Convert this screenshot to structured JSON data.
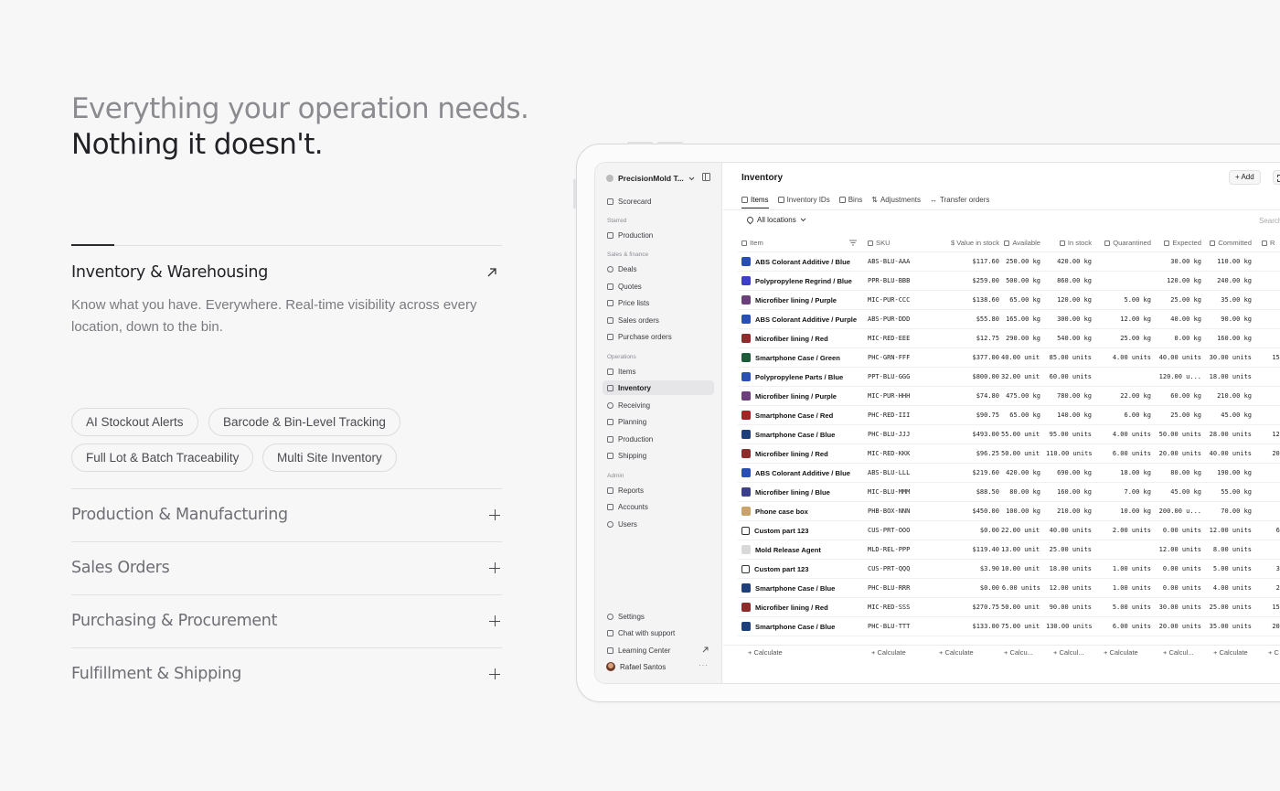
{
  "headline": {
    "line1": "Everything your operation needs.",
    "line2": "Nothing it doesn't."
  },
  "accordion": {
    "open": {
      "title": "Inventory & Warehousing",
      "description": "Know what you have. Everywhere. Real-time visibility across every location, down to the bin.",
      "tags": [
        "AI Stockout Alerts",
        "Barcode & Bin-Level Tracking",
        "Full Lot & Batch Traceability",
        "Multi Site Inventory"
      ]
    },
    "closed": [
      "Production & Manufacturing",
      "Sales Orders",
      "Purchasing & Procurement",
      "Fulfillment & Shipping"
    ]
  },
  "app": {
    "workspace": "PrecisionMold T...",
    "sidebar": {
      "top_item": "Scorecard",
      "sections": [
        {
          "label": "Starred",
          "items": [
            "Production"
          ]
        },
        {
          "label": "Sales & finance",
          "items": [
            "Deals",
            "Quotes",
            "Price lists",
            "Sales orders",
            "Purchase orders"
          ]
        },
        {
          "label": "Operations",
          "items": [
            "Items",
            "Inventory",
            "Receiving",
            "Planning",
            "Production",
            "Shipping"
          ]
        },
        {
          "label": "Admin",
          "items": [
            "Reports",
            "Accounts",
            "Users"
          ]
        }
      ],
      "footer": [
        "Settings",
        "Chat with support",
        "Learning Center"
      ],
      "user": "Rafael Santos"
    },
    "page_title": "Inventory",
    "add_label": "+ Add",
    "tabs": [
      "Items",
      "Inventory IDs",
      "Bins",
      "Adjustments",
      "Transfer orders"
    ],
    "location_filter": "All locations",
    "search_placeholder": "Search",
    "columns": [
      "Item",
      "SKU",
      "Value in stock",
      "Available",
      "In stock",
      "Quarantined",
      "Expected",
      "Committed",
      "R"
    ],
    "rows": [
      {
        "item": "ABS Colorant Additive / Blue",
        "sku": "ABS-BLU-AAA",
        "value": "$117.60",
        "available": "250.00 kg",
        "in_stock": "420.00 kg",
        "quarantined": "",
        "expected": "30.00 kg",
        "committed": "110.00 kg",
        "rest": "",
        "thumb": "#2a4fb3"
      },
      {
        "item": "Polypropylene Regrind / Blue",
        "sku": "PPR-BLU-BBB",
        "value": "$259.00",
        "available": "500.00 kg",
        "in_stock": "860.00 kg",
        "quarantined": "",
        "expected": "120.00 kg",
        "committed": "240.00 kg",
        "rest": "",
        "thumb": "#3d3fc9"
      },
      {
        "item": "Microfiber lining / Purple",
        "sku": "MIC-PUR-CCC",
        "value": "$138.60",
        "available": "65.00 kg",
        "in_stock": "120.00 kg",
        "quarantined": "5.00 kg",
        "expected": "25.00 kg",
        "committed": "35.00 kg",
        "rest": "2",
        "thumb": "#6a3f7a"
      },
      {
        "item": "ABS Colorant Additive / Purple",
        "sku": "ABS-PUR-DDD",
        "value": "$55.80",
        "available": "165.00 kg",
        "in_stock": "300.00 kg",
        "quarantined": "12.00 kg",
        "expected": "40.00 kg",
        "committed": "90.00 kg",
        "rest": "4",
        "thumb": "#2a4fb3"
      },
      {
        "item": "Microfiber lining / Red",
        "sku": "MIC-RED-EEE",
        "value": "$12.75",
        "available": "290.00 kg",
        "in_stock": "540.00 kg",
        "quarantined": "25.00 kg",
        "expected": "0.00 kg",
        "committed": "160.00 kg",
        "rest": "9",
        "thumb": "#8e2b2b"
      },
      {
        "item": "Smartphone Case / Green",
        "sku": "PHC-GRN-FFF",
        "value": "$377.00",
        "available": "40.00 units",
        "in_stock": "85.00 units",
        "quarantined": "4.00 units",
        "expected": "40.00 units",
        "committed": "30.00 units",
        "rest": "15.",
        "thumb": "#1f5a3a"
      },
      {
        "item": "Polypropylene Parts / Blue",
        "sku": "PPT-BLU-GGG",
        "value": "$800.00",
        "available": "32.00 units",
        "in_stock": "60.00 units",
        "quarantined": "",
        "expected": "120.00 u...",
        "committed": "18.00 units",
        "rest": "",
        "thumb": "#2a4fb3"
      },
      {
        "item": "Microfiber lining / Purple",
        "sku": "MIC-PUR-HHH",
        "value": "$74.80",
        "available": "475.00 kg",
        "in_stock": "780.00 kg",
        "quarantined": "22.00 kg",
        "expected": "60.00 kg",
        "committed": "210.00 kg",
        "rest": "9",
        "thumb": "#6a3f7a"
      },
      {
        "item": "Smartphone Case / Red",
        "sku": "PHC-RED-III",
        "value": "$90.75",
        "available": "65.00 kg",
        "in_stock": "140.00 kg",
        "quarantined": "6.00 kg",
        "expected": "25.00 kg",
        "committed": "45.00 kg",
        "rest": "3",
        "thumb": "#a32626"
      },
      {
        "item": "Smartphone Case / Blue",
        "sku": "PHC-BLU-JJJ",
        "value": "$493.00",
        "available": "55.00 units",
        "in_stock": "95.00 units",
        "quarantined": "4.00 units",
        "expected": "50.00 units",
        "committed": "28.00 units",
        "rest": "12.",
        "thumb": "#1d3f7a"
      },
      {
        "item": "Microfiber lining / Red",
        "sku": "MIC-RED-KKK",
        "value": "$96.25",
        "available": "50.00 units",
        "in_stock": "110.00 units",
        "quarantined": "6.00 units",
        "expected": "20.00 units",
        "committed": "40.00 units",
        "rest": "20.",
        "thumb": "#8e2b2b"
      },
      {
        "item": "ABS Colorant Additive / Blue",
        "sku": "ABS-BLU-LLL",
        "value": "$219.60",
        "available": "420.00 kg",
        "in_stock": "690.00 kg",
        "quarantined": "18.00 kg",
        "expected": "80.00 kg",
        "committed": "190.00 kg",
        "rest": "8",
        "thumb": "#2a4fb3"
      },
      {
        "item": "Microfiber lining / Blue",
        "sku": "MIC-BLU-MMM",
        "value": "$88.50",
        "available": "80.00 kg",
        "in_stock": "160.00 kg",
        "quarantined": "7.00 kg",
        "expected": "45.00 kg",
        "committed": "55.00 kg",
        "rest": "2",
        "thumb": "#3a3f8e"
      },
      {
        "item": "Phone case box",
        "sku": "PHB-BOX-NNN",
        "value": "$450.00",
        "available": "100.00 kg",
        "in_stock": "210.00 kg",
        "quarantined": "10.00 kg",
        "expected": "200.00 u...",
        "committed": "70.00 kg",
        "rest": "4",
        "thumb": "#c9a36a"
      },
      {
        "item": "Custom part 123",
        "sku": "CUS-PRT-OOO",
        "value": "$0.00",
        "available": "22.00 units",
        "in_stock": "40.00 units",
        "quarantined": "2.00 units",
        "expected": "0.00 units",
        "committed": "12.00 units",
        "rest": "6.",
        "thumb": ""
      },
      {
        "item": "Mold Release Agent",
        "sku": "MLD-REL-PPP",
        "value": "$119.40",
        "available": "13.00 units",
        "in_stock": "25.00 units",
        "quarantined": "",
        "expected": "12.00 units",
        "committed": "8.00 units",
        "rest": "",
        "thumb": "#d8d8d8"
      },
      {
        "item": "Custom part 123",
        "sku": "CUS-PRT-QQQ",
        "value": "$3.90",
        "available": "10.00 units",
        "in_stock": "18.00 units",
        "quarantined": "1.00 units",
        "expected": "0.00 units",
        "committed": "5.00 units",
        "rest": "3.",
        "thumb": ""
      },
      {
        "item": "Smartphone Case / Blue",
        "sku": "PHC-BLU-RRR",
        "value": "$0.00",
        "available": "6.00 units",
        "in_stock": "12.00 units",
        "quarantined": "1.00 units",
        "expected": "0.00 units",
        "committed": "4.00 units",
        "rest": "2.",
        "thumb": "#1d3f7a"
      },
      {
        "item": "Microfiber lining / Red",
        "sku": "MIC-RED-SSS",
        "value": "$270.75",
        "available": "50.00 units",
        "in_stock": "90.00 units",
        "quarantined": "5.00 units",
        "expected": "30.00 units",
        "committed": "25.00 units",
        "rest": "15.",
        "thumb": "#8e2b2b"
      },
      {
        "item": "Smartphone Case / Blue",
        "sku": "PHC-BLU-TTT",
        "value": "$133.00",
        "available": "75.00 units",
        "in_stock": "130.00 units",
        "quarantined": "6.00 units",
        "expected": "20.00 units",
        "committed": "35.00 units",
        "rest": "20.",
        "thumb": "#1d3f7a"
      }
    ],
    "calc_labels": [
      "+ Calculate",
      "+ Calculate",
      "+ Calculate",
      "+ Calcu...",
      "+ Calcul...",
      "+ Calculate",
      "+ Calcul...",
      "+ Calculate",
      "+ C"
    ]
  }
}
